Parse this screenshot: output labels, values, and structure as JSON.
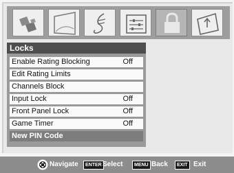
{
  "menu": {
    "title": "Locks",
    "items": [
      {
        "label": "Enable Rating Blocking",
        "value": "Off"
      },
      {
        "label": "Edit Rating Limits",
        "value": ""
      },
      {
        "label": "Channels Block",
        "value": ""
      },
      {
        "label": "Input Lock",
        "value": "Off"
      },
      {
        "label": "Front Panel Lock",
        "value": "Off"
      },
      {
        "label": "Game Timer",
        "value": "Off"
      },
      {
        "label": "New PIN Code",
        "value": ""
      }
    ]
  },
  "icons": [
    "picture-icon",
    "sound-icon",
    "music-note-icon",
    "setup-icon",
    "lock-icon",
    "applications-icon"
  ],
  "hints": {
    "navigate": "Navigate",
    "enter_key": "ENTER",
    "select": "Select",
    "menu_key": "MENU",
    "back": "Back",
    "exit_key": "EXIT",
    "exit": "Exit"
  }
}
